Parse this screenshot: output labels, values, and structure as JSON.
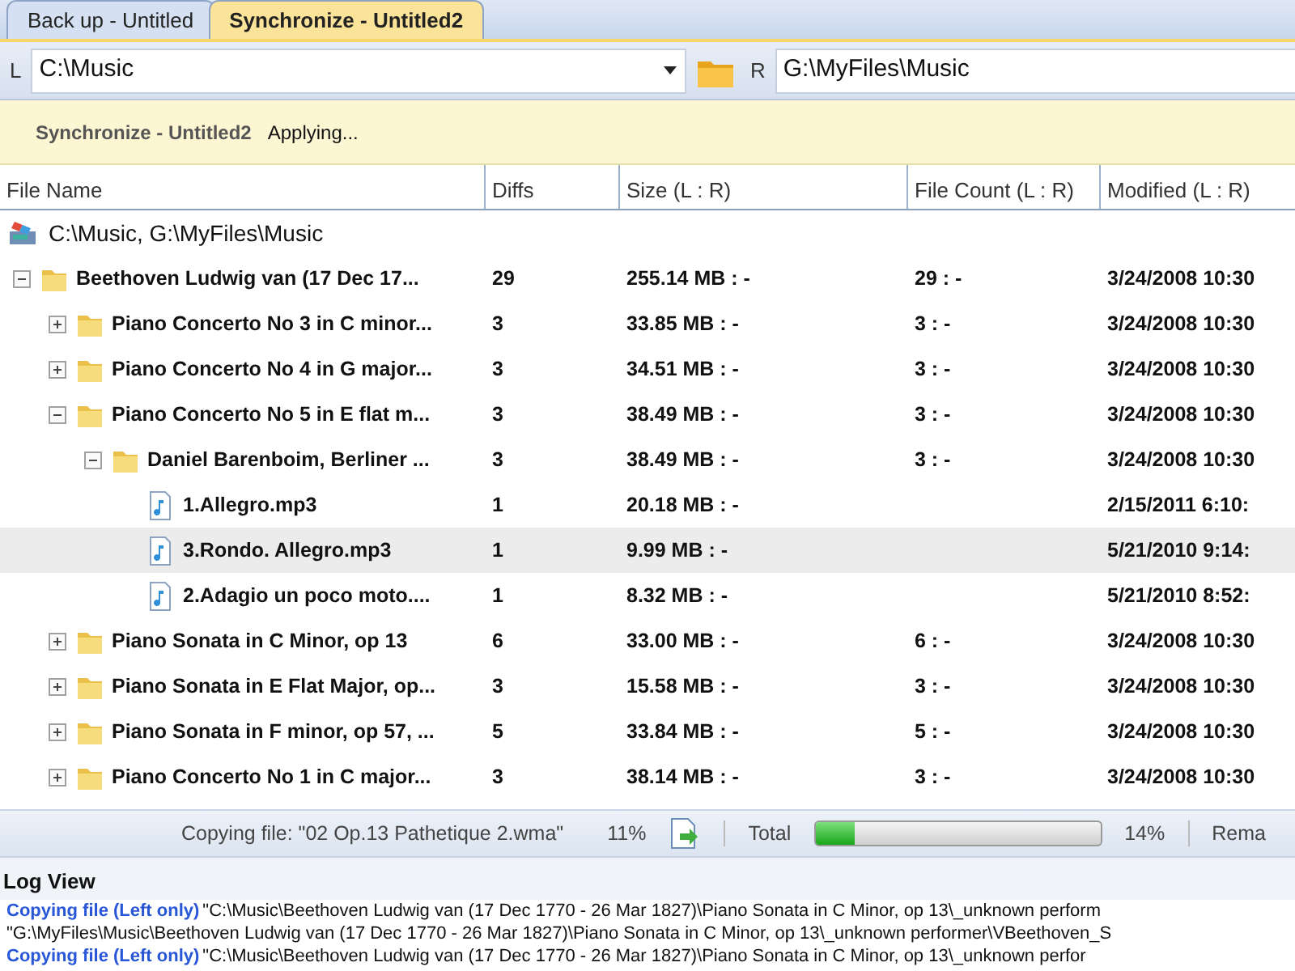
{
  "tabs": [
    {
      "label": "Back up - Untitled",
      "selected": false
    },
    {
      "label": "Synchronize - Untitled2",
      "selected": true
    }
  ],
  "paths": {
    "left_label": "L",
    "left_value": "C:\\Music",
    "right_label": "R",
    "right_value": "G:\\MyFiles\\Music"
  },
  "banner": {
    "title": "Synchronize - Untitled2",
    "status": "Applying..."
  },
  "table": {
    "columns": [
      "File Name",
      "Diffs",
      "Size (L : R)",
      "File Count (L : R)",
      "Modified (L : R)"
    ],
    "tree": {
      "kind": "root",
      "name": "C:\\Music, G:\\MyFiles\\Music",
      "selected": false,
      "children": [
        {
          "kind": "folder",
          "name": "Beethoven Ludwig van (17 Dec 17...",
          "diffs": "29",
          "size": "255.14 MB : -",
          "count": "29 : -",
          "modified": "3/24/2008 10:30",
          "expanded": true,
          "selected": false,
          "children": [
            {
              "kind": "folder",
              "name": "Piano Concerto No 3 in C minor...",
              "diffs": "3",
              "size": "33.85 MB : -",
              "count": "3 : -",
              "modified": "3/24/2008 10:30",
              "expanded": false,
              "selected": false
            },
            {
              "kind": "folder",
              "name": "Piano Concerto No 4 in G major...",
              "diffs": "3",
              "size": "34.51 MB : -",
              "count": "3 : -",
              "modified": "3/24/2008 10:30",
              "expanded": false,
              "selected": false
            },
            {
              "kind": "folder",
              "name": "Piano Concerto No 5 in E flat m...",
              "diffs": "3",
              "size": "38.49 MB : -",
              "count": "3 : -",
              "modified": "3/24/2008 10:30",
              "expanded": true,
              "selected": false,
              "children": [
                {
                  "kind": "folder",
                  "name": "Daniel Barenboim, Berliner ...",
                  "diffs": "3",
                  "size": "38.49 MB : -",
                  "count": "3 : -",
                  "modified": "3/24/2008 10:30",
                  "expanded": true,
                  "selected": false,
                  "children": [
                    {
                      "kind": "file",
                      "name": "1.Allegro.mp3",
                      "diffs": "1",
                      "size": "20.18 MB : -",
                      "modified": "2/15/2011 6:10:",
                      "selected": false
                    },
                    {
                      "kind": "file",
                      "name": "3.Rondo. Allegro.mp3",
                      "diffs": "1",
                      "size": "9.99 MB : -",
                      "modified": "5/21/2010 9:14:",
                      "selected": true
                    },
                    {
                      "kind": "file",
                      "name": "2.Adagio un poco moto....",
                      "diffs": "1",
                      "size": "8.32 MB : -",
                      "modified": "5/21/2010 8:52:",
                      "selected": false
                    }
                  ]
                }
              ]
            },
            {
              "kind": "folder",
              "name": "Piano Sonata in C Minor, op 13",
              "diffs": "6",
              "size": "33.00 MB : -",
              "count": "6 : -",
              "modified": "3/24/2008 10:30",
              "expanded": false,
              "selected": false
            },
            {
              "kind": "folder",
              "name": "Piano Sonata in E Flat Major, op...",
              "diffs": "3",
              "size": "15.58 MB : -",
              "count": "3 : -",
              "modified": "3/24/2008 10:30",
              "expanded": false,
              "selected": false
            },
            {
              "kind": "folder",
              "name": "Piano Sonata in F minor, op 57, ...",
              "diffs": "5",
              "size": "33.84 MB : -",
              "count": "5 : -",
              "modified": "3/24/2008 10:30",
              "expanded": false,
              "selected": false
            },
            {
              "kind": "folder",
              "name": "Piano Concerto No 1 in C major...",
              "diffs": "3",
              "size": "38.14 MB : -",
              "count": "3 : -",
              "modified": "3/24/2008 10:30",
              "expanded": false,
              "selected": false
            }
          ]
        }
      ]
    }
  },
  "status_bar": {
    "current": "Copying file: \"02 Op.13 Pathetique 2.wma\"",
    "current_percent": "11%",
    "total_label": "Total",
    "level": 0.14,
    "total_percent": "14%",
    "remaining": "Rema"
  },
  "log": {
    "title": "Log View",
    "lines": [
      {
        "action": "Copying file (Left only)",
        "text": "\"C:\\Music\\Beethoven Ludwig van (17 Dec 1770 - 26 Mar 1827)\\Piano Sonata in C Minor, op 13\\_unknown perform"
      },
      {
        "text": "\"G:\\MyFiles\\Music\\Beethoven Ludwig van (17 Dec 1770 - 26 Mar 1827)\\Piano Sonata in C Minor, op 13\\_unknown performer\\VBeethoven_S"
      },
      {
        "action": "Copying file (Left only)",
        "text": "\"C:\\Music\\Beethoven Ludwig van (17 Dec 1770 - 26 Mar 1827)\\Piano Sonata in C Minor, op 13\\_unknown perfor"
      }
    ]
  }
}
